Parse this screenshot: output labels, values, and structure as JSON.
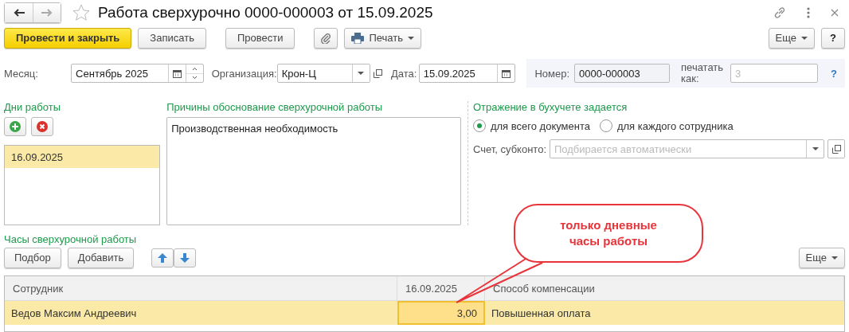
{
  "header": {
    "title": "Работа сверхурочно 0000-000003 от 15.09.2025",
    "favorite": false
  },
  "toolbar": {
    "buttons": [
      {
        "kind": "primary",
        "label": "Провести и закрыть"
      },
      {
        "kind": "plain",
        "label": "Записать"
      },
      {
        "kind": "plain",
        "label": "Провести"
      },
      {
        "kind": "clip"
      },
      {
        "kind": "print",
        "label": "Печать"
      }
    ],
    "more": "Еще",
    "help": "?"
  },
  "fields": {
    "month": {
      "label": "Месяц:",
      "value": "Сентябрь 2025"
    },
    "organization": {
      "label": "Организация:",
      "value": "Крон-Ц"
    },
    "date": {
      "label": "Дата:",
      "value": "15.09.2025"
    },
    "number": {
      "label": "Номер:",
      "value": "0000-000003"
    },
    "print_as": {
      "label": "печатать как:",
      "placeholder": "3"
    },
    "help": "?"
  },
  "days": {
    "title": "Дни работы",
    "items": [
      {
        "text": "16.09.2025",
        "selected": true
      }
    ]
  },
  "reasons": {
    "title": "Причины обоснование сверхурочной работы",
    "value": "Производственная необходимость"
  },
  "accounting": {
    "title": "Отражение в бухучете задается",
    "options": [
      {
        "label": "для всего документа",
        "selected": true
      },
      {
        "label": "для каждого сотрудника",
        "selected": false
      }
    ],
    "account": {
      "label": "Счет, субконто:",
      "placeholder": "Подбирается автоматически"
    }
  },
  "hours": {
    "title": "Часы сверхурочной работы",
    "buttons": [
      "Подбор",
      "Добавить"
    ],
    "more": "Еще",
    "columns": [
      "Сотрудник",
      "16.09.2025",
      "Способ компенсации"
    ],
    "rows": [
      {
        "selected": true,
        "cells": [
          {
            "text": "Ведов Максим Андреевич",
            "focused": false
          },
          {
            "text": "3,00",
            "focused": true
          },
          {
            "text": "Повышенная оплата",
            "focused": false
          }
        ]
      }
    ]
  },
  "callout": {
    "text": "только дневные часы работы"
  }
}
